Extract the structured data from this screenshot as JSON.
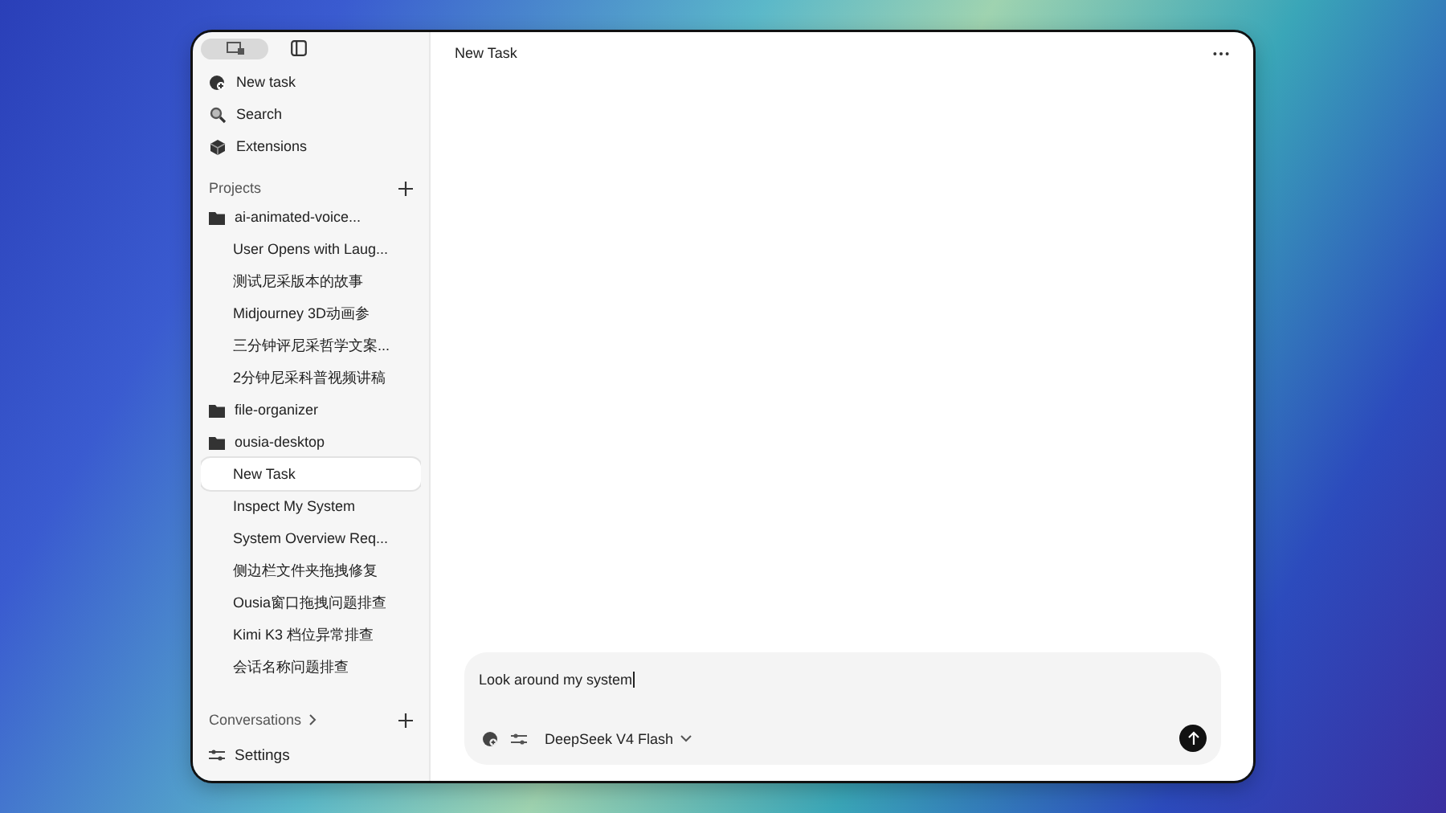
{
  "sidebar": {
    "nav": [
      {
        "label": "New task"
      },
      {
        "label": "Search"
      },
      {
        "label": "Extensions"
      }
    ],
    "projects_heading": "Projects",
    "projects": [
      {
        "name": "ai-animated-voice...",
        "children": [
          {
            "label": "User Opens with Laug...",
            "selected": false
          },
          {
            "label": "测试尼采版本的故事",
            "selected": false
          },
          {
            "label": "Midjourney 3D动画参",
            "selected": false
          },
          {
            "label": "三分钟评尼采哲学文案...",
            "selected": false
          },
          {
            "label": "2分钟尼采科普视频讲稿",
            "selected": false
          }
        ]
      },
      {
        "name": "file-organizer"
      },
      {
        "name": "ousia-desktop",
        "children": [
          {
            "label": "New Task",
            "selected": true
          },
          {
            "label": "Inspect My System",
            "selected": false
          },
          {
            "label": "System Overview Req...",
            "selected": false
          },
          {
            "label": "侧边栏文件夹拖拽修复",
            "selected": false
          },
          {
            "label": "Ousia窗口拖拽问题排查",
            "selected": false
          },
          {
            "label": "Kimi K3 档位异常排查",
            "selected": false
          },
          {
            "label": "会话名称问题排查",
            "selected": false
          }
        ]
      }
    ],
    "conversations_heading": "Conversations",
    "settings": "Settings"
  },
  "main": {
    "title": "New Task",
    "composer": {
      "value": "Look around my system",
      "model": "DeepSeek V4 Flash"
    }
  }
}
